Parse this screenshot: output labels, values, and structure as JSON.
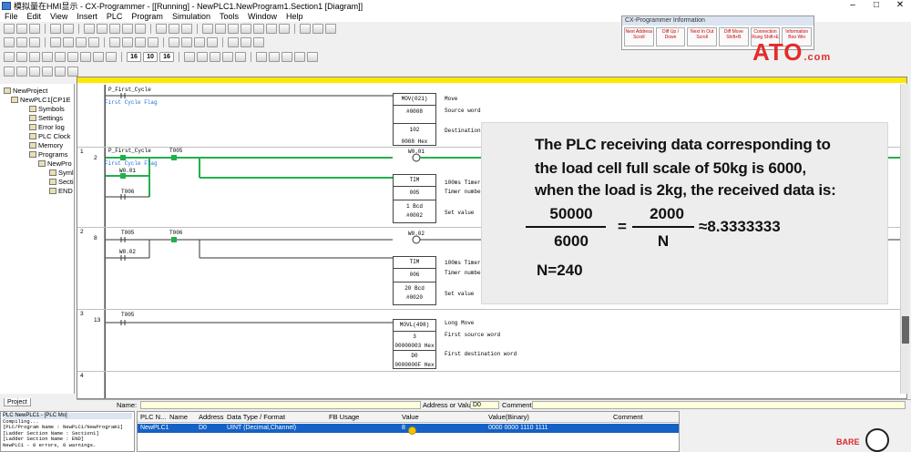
{
  "window": {
    "title": "模拟量在HMI显示 - CX-Programmer - [[Running] - NewPLC1.NewProgram1.Section1 [Diagram]]",
    "controls": [
      "–",
      "□",
      "✕"
    ]
  },
  "menu": [
    "File",
    "Edit",
    "View",
    "Insert",
    "PLC",
    "Program",
    "Simulation",
    "Tools",
    "Window",
    "Help"
  ],
  "info_window": {
    "title": "CX-Programmer Information",
    "keys": [
      "Next Address Scroll",
      "Diff Up / Down",
      "Next In Out Scroll",
      "Diff Move Shift+B",
      "Connection Rung Shift+E",
      "Information Boo Win"
    ]
  },
  "logo": {
    "text": "ATO",
    "suffix": ".com"
  },
  "project_tree": {
    "items": [
      "NewProject",
      "NewPLC1[CP1E",
      "Symbols",
      "Settings",
      "Error log",
      "PLC Clock",
      "Memory",
      "Programs",
      "NewPro",
      "Syml",
      "Secti",
      "END"
    ],
    "tab": "Project"
  },
  "ladder": {
    "rungs": [
      {
        "index": "",
        "step": ""
      },
      {
        "index": "1",
        "step": "2"
      },
      {
        "index": "2",
        "step": "8"
      },
      {
        "index": "3",
        "step": "13"
      },
      {
        "index": "4",
        "step": ""
      }
    ],
    "rung0": {
      "contact": "P_First_Cycle",
      "contact_comment": "First Cycle Flag",
      "box": {
        "name": "MOV(021)",
        "op1": "#0008",
        "op2": "102",
        "op3": "0008 Hex"
      },
      "comments": {
        "c1": "Move",
        "c2": "Source word",
        "c3": "Destination"
      }
    },
    "rung1": {
      "contact1": "P_First_Cycle",
      "contact1_comment": "First Cycle Flag",
      "contact2": "T005",
      "coil": "W0.01",
      "latch": "W0.01",
      "contact3": "T006",
      "box": {
        "name": "TIM",
        "op1": "005",
        "op2": "1 Bcd",
        "op3": "#0002"
      },
      "comments": {
        "c1": "100ms Timer (Timer) [BCD Type]",
        "c2": "Timer number",
        "c3": "Set value"
      }
    },
    "rung2": {
      "contact1": "T005",
      "contact2": "T006",
      "coil": "W0.02",
      "latch": "W0.02",
      "box": {
        "name": "TIM",
        "op1": "006",
        "op2": "20 Bcd",
        "op3": "#0020"
      },
      "comments": {
        "c1": "100ms Timer (Timer) [BCD Type]",
        "c2": "Timer number",
        "c3": "Set value"
      }
    },
    "rung3": {
      "contact1": "T005",
      "box": {
        "name": "MOVL(498)",
        "op1": "3",
        "op2": "00000003 Hex",
        "op3": "D0",
        "op4": "0000000F Hex"
      },
      "comments": {
        "c1": "Long Move",
        "c2": "First source word",
        "c3": "First destination word"
      }
    }
  },
  "overlay": {
    "line1": "The PLC receiving data corresponding to",
    "line2": "the load cell full scale of 50kg is 6000,",
    "line3": "when the load is 2kg, the received data is:",
    "num1": "50000",
    "den1": "6000",
    "eq": "=",
    "num2": "2000",
    "den2": "N",
    "approx": "≈8.3333333",
    "result": "N=240"
  },
  "name_bar": {
    "name_label": "Name:",
    "addr_label": "Address or Value:",
    "addr_value": "D0",
    "comment_label": "Comment:"
  },
  "output": {
    "header": "PLC   NewPLC1 - [PLC Mo]",
    "lines": [
      "Compiling...",
      "[PLC/Program Name : NewPLC1/NewProgram1]",
      "[Ladder Section Name : Section1]",
      "[Ladder Section Name : END]",
      "NewPLC1 - 0 errors, 0 warnings."
    ]
  },
  "watch": {
    "headers": [
      "PLC N...",
      "Name",
      "Address",
      "Data Type / Format",
      "FB Usage",
      "Value",
      "Value(Binary)",
      "Comment"
    ],
    "row": {
      "plc": "NewPLC1",
      "name": "",
      "address": "D0",
      "type": "UINT (Decimal,Channel)",
      "fb": "",
      "value": "8",
      "binary": "0000 0000 1110 1111",
      "comment": ""
    }
  },
  "watermark": "BARE"
}
